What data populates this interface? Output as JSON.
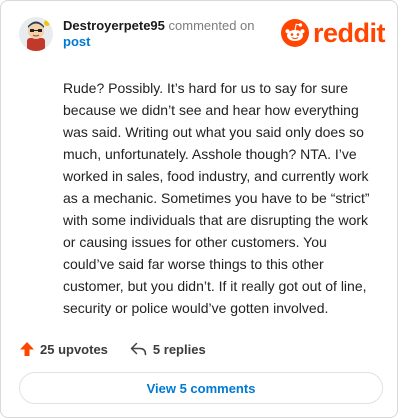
{
  "comment": {
    "username": "Destroyerpete95",
    "action_text": "commented on",
    "target_link": "post",
    "body": "Rude? Possibly. It’s hard for us to say for sure because we didn’t see and hear how everything was said. Writing out what you said only does so much, unfortunately. Asshole though? NTA. I’ve worked in sales, food industry, and currently work as a mechanic. Sometimes you have to be “strict” with some individuals that are disrupting the work or causing issues for other customers. You could’ve said far worse things to this other customer, but you didn’t. If it really got out of line, security or police would’ve gotten involved."
  },
  "brand": {
    "wordmark": "reddit",
    "color": "#ff4500",
    "icon": "reddit-snoo-icon"
  },
  "stats": {
    "upvotes_label": "25 upvotes",
    "replies_label": "5 replies",
    "upvote_icon": "upvote-arrow-icon",
    "reply_icon": "reply-arrow-icon"
  },
  "footer": {
    "view_comments_label": "View 5 comments"
  },
  "colors": {
    "accent_blue": "#0079d3",
    "upvote_orange": "#ff4500",
    "muted": "#7c7c7c"
  }
}
